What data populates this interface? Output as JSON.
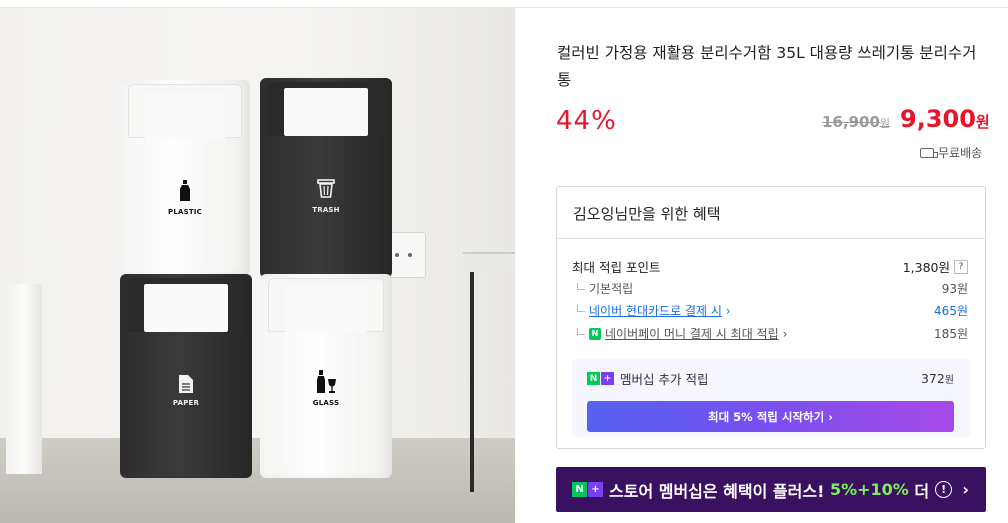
{
  "photo": {
    "bins": [
      {
        "label": "PLASTIC",
        "icon": "bottle-icon"
      },
      {
        "label": "TRASH",
        "icon": "trash-can-icon"
      },
      {
        "label": "PAPER",
        "icon": "document-icon"
      },
      {
        "label": "GLASS",
        "icon": "glass-bottle-icon"
      }
    ]
  },
  "product": {
    "title": "컬러빈 가정용 재활용 분리수거함 35L 대용량 쓰레기통 분리수거통",
    "discount": "44%",
    "original_price": "16,900",
    "original_unit": "원",
    "price": "9,300",
    "price_unit": "원",
    "delivery": "무료배송"
  },
  "benefit": {
    "heading": "김오잉님만을 위한 혜택",
    "max_points_label": "최대 적립 포인트",
    "max_points_value": "1,380원",
    "help": "?",
    "rows": [
      {
        "label": "기본적립",
        "value": "93원"
      },
      {
        "label": "네이버 현대카드로 결제 시",
        "value": "465원"
      },
      {
        "label": "네이버페이 머니 결제 시 최대 적립",
        "value": "185원"
      }
    ],
    "membership_label": "멤버십 추가 적립",
    "membership_value": "372",
    "membership_unit": "원",
    "membership_button": "최대 5% 적립 시작하기"
  },
  "banner": {
    "text_a": "스토어 멤버십은 혜택이 플러스! ",
    "text_green": "5%+10%",
    "text_b": " 더"
  },
  "colors": {
    "accent_red": "#e2172c",
    "naver_green": "#03c75a",
    "membership_purple": "#3a1160",
    "link_blue": "#1a6de3"
  }
}
